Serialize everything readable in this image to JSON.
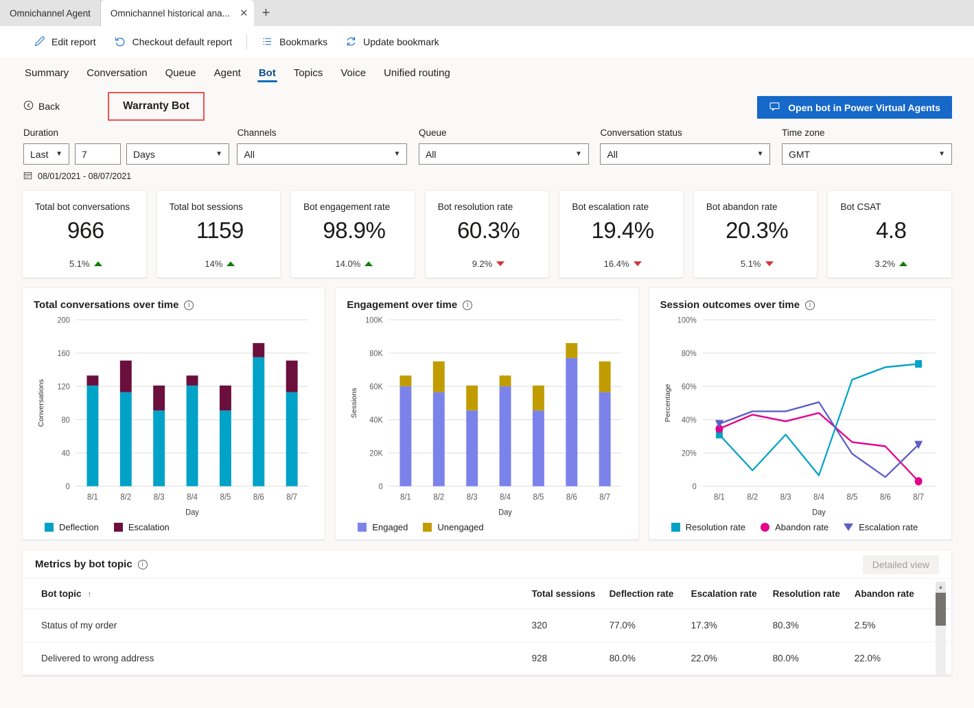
{
  "browser": {
    "tabs": [
      {
        "title": "Omnichannel Agent",
        "active": false
      },
      {
        "title": "Omnichannel historical ana...",
        "active": true
      }
    ],
    "new_tab_label": "+",
    "close_label": "✕"
  },
  "commandbar": {
    "items": [
      {
        "icon": "pencil-icon",
        "label": "Edit report"
      },
      {
        "icon": "undo-icon",
        "label": "Checkout default report"
      },
      {
        "icon": "list-icon",
        "label": "Bookmarks"
      },
      {
        "icon": "refresh-icon",
        "label": "Update bookmark"
      }
    ]
  },
  "nav": {
    "tabs": [
      {
        "label": "Summary",
        "selected": false
      },
      {
        "label": "Conversation",
        "selected": false
      },
      {
        "label": "Queue",
        "selected": false
      },
      {
        "label": "Agent",
        "selected": false
      },
      {
        "label": "Bot",
        "selected": true
      },
      {
        "label": "Topics",
        "selected": false
      },
      {
        "label": "Voice",
        "selected": false
      },
      {
        "label": "Unified routing",
        "selected": false
      }
    ]
  },
  "header": {
    "back_label": "Back",
    "bot_name": "Warranty Bot",
    "highlight_color": "#f0504d",
    "pva_button_label": "Open bot in Power Virtual Agents",
    "pva_button_color": "#1668c9"
  },
  "filters": {
    "duration": {
      "label": "Duration",
      "relative": "Last",
      "amount": "7",
      "unit": "Days"
    },
    "channels": {
      "label": "Channels",
      "value": "All"
    },
    "queue": {
      "label": "Queue",
      "value": "All"
    },
    "conversation_status": {
      "label": "Conversation status",
      "value": "All"
    },
    "time_zone": {
      "label": "Time zone",
      "value": "GMT"
    },
    "date_range": "08/01/2021 - 08/07/2021"
  },
  "kpis": [
    {
      "title": "Total bot conversations",
      "value": "966",
      "delta": "5.1%",
      "dir": "up"
    },
    {
      "title": "Total bot sessions",
      "value": "1159",
      "delta": "14%",
      "dir": "up"
    },
    {
      "title": "Bot engagement rate",
      "value": "98.9%",
      "delta": "14.0%",
      "dir": "up"
    },
    {
      "title": "Bot resolution rate",
      "value": "60.3%",
      "delta": "9.2%",
      "dir": "down"
    },
    {
      "title": "Bot escalation rate",
      "value": "19.4%",
      "delta": "16.4%",
      "dir": "down"
    },
    {
      "title": "Bot abandon rate",
      "value": "20.3%",
      "delta": "5.1%",
      "dir": "down"
    },
    {
      "title": "Bot CSAT",
      "value": "4.8",
      "delta": "3.2%",
      "dir": "up"
    }
  ],
  "chart_data": [
    {
      "type": "bar",
      "stacked": true,
      "title": "Total conversations over time",
      "xlabel": "Day",
      "ylabel": "Conversations",
      "categories": [
        "8/1",
        "8/2",
        "8/3",
        "8/4",
        "8/5",
        "8/6",
        "8/7"
      ],
      "ylim": [
        0,
        200
      ],
      "yticks": [
        0,
        40,
        80,
        120,
        160,
        200
      ],
      "ytick_labels": [
        "0",
        "40",
        "80",
        "120",
        "160",
        "200"
      ],
      "grid": true,
      "legend_position": "bottom",
      "series": [
        {
          "name": "Deflection",
          "color": "#00A2C7",
          "values": [
            121,
            113,
            91,
            121,
            91,
            155,
            113
          ]
        },
        {
          "name": "Escalation",
          "color": "#6B0F3C",
          "values": [
            12,
            38,
            30,
            12,
            30,
            17,
            38
          ]
        }
      ]
    },
    {
      "type": "bar",
      "stacked": true,
      "title": "Engagement over time",
      "xlabel": "Day",
      "ylabel": "Sessions",
      "categories": [
        "8/1",
        "8/2",
        "8/3",
        "8/4",
        "8/5",
        "8/6",
        "8/7"
      ],
      "ylim": [
        0,
        100000
      ],
      "yticks": [
        0,
        20000,
        40000,
        60000,
        80000,
        100000
      ],
      "ytick_labels": [
        "0",
        "20K",
        "40K",
        "60K",
        "80K",
        "100K"
      ],
      "grid": true,
      "legend_position": "bottom",
      "series": [
        {
          "name": "Engaged",
          "color": "#7B83EB",
          "values": [
            60000,
            56500,
            45500,
            60000,
            45500,
            77000,
            56500
          ]
        },
        {
          "name": "Unengaged",
          "color": "#C19C00",
          "values": [
            6500,
            18500,
            15000,
            6500,
            15000,
            9000,
            18500
          ]
        }
      ]
    },
    {
      "type": "line",
      "title": "Session outcomes over time",
      "xlabel": "Day",
      "ylabel": "Percentage",
      "categories": [
        "8/1",
        "8/2",
        "8/3",
        "8/4",
        "8/5",
        "8/6",
        "8/7"
      ],
      "ylim": [
        0,
        100
      ],
      "yticks": [
        0,
        20,
        40,
        60,
        80,
        100
      ],
      "ytick_labels": [
        "0",
        "20%",
        "40%",
        "60%",
        "80%",
        "100%"
      ],
      "grid": true,
      "legend_position": "bottom",
      "series": [
        {
          "name": "Resolution rate",
          "color": "#00A2C7",
          "marker": "square",
          "values": [
            31,
            9.5,
            31,
            6.5,
            64,
            71.5,
            73.5
          ]
        },
        {
          "name": "Abandon rate",
          "color": "#E3008C",
          "marker": "circle",
          "values": [
            34.5,
            43,
            39,
            44,
            26.5,
            24,
            3
          ]
        },
        {
          "name": "Escalation rate",
          "color": "#5B5FC7",
          "marker": "triangle-down",
          "values": [
            37.5,
            45,
            45,
            50.5,
            19.5,
            5.5,
            25
          ]
        }
      ]
    }
  ],
  "table": {
    "title": "Metrics by bot topic",
    "detailed_view_label": "Detailed view",
    "sort_column": "Bot topic",
    "sort_arrow": "↑",
    "columns": [
      "Bot topic",
      "Total sessions",
      "Deflection rate",
      "Escalation rate",
      "Resolution rate",
      "Abandon rate"
    ],
    "rows": [
      {
        "topic": "Status of my order",
        "total_sessions": "320",
        "deflection_rate": "77.0%",
        "escalation_rate": "17.3%",
        "resolution_rate": "80.3%",
        "abandon_rate": "2.5%"
      },
      {
        "topic": "Delivered to wrong address",
        "total_sessions": "928",
        "deflection_rate": "80.0%",
        "escalation_rate": "22.0%",
        "resolution_rate": "80.0%",
        "abandon_rate": "22.0%"
      }
    ]
  }
}
